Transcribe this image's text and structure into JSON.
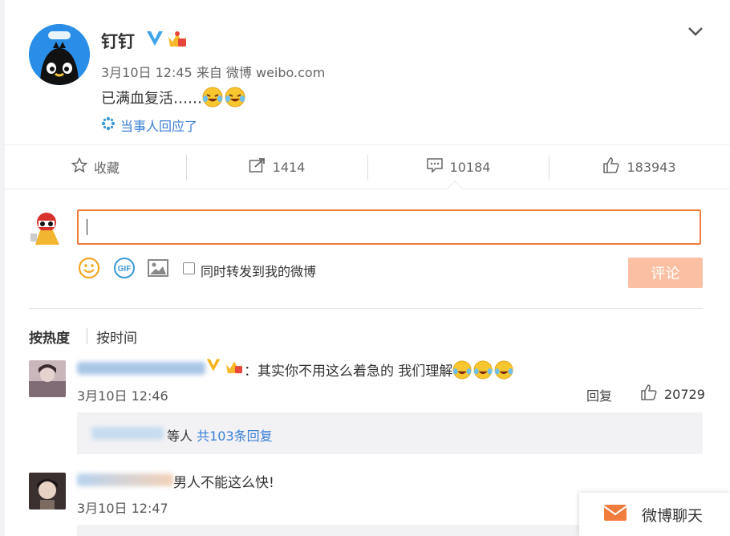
{
  "post": {
    "author": "钉钉",
    "meta": "3月10日 12:45 来自 微博 weibo.com",
    "text": "已满血复活……",
    "responded_label": "当事人回应了"
  },
  "actions": {
    "favorite": "收藏",
    "repost": "1414",
    "comment": "10184",
    "like": "183943"
  },
  "composer": {
    "forward_label": "同时转发到我的微博",
    "submit_label": "评论"
  },
  "sort": {
    "hot": "按热度",
    "time": "按时间"
  },
  "comments": [
    {
      "text": "：其实你不用这么着急的  我们理解",
      "time": "3月10日 12:46",
      "reply_label": "回复",
      "likes": "20729",
      "replies_suffix": "等人",
      "replies_link": "共103条回复"
    },
    {
      "text": "男人不能这么快!",
      "time": "3月10日 12:47"
    }
  ],
  "chat": {
    "label": "微博聊天"
  },
  "colors": {
    "accent_orange": "#f07c3e",
    "link_blue": "#3a7fd5",
    "submit_disabled": "#fbc0a3"
  }
}
